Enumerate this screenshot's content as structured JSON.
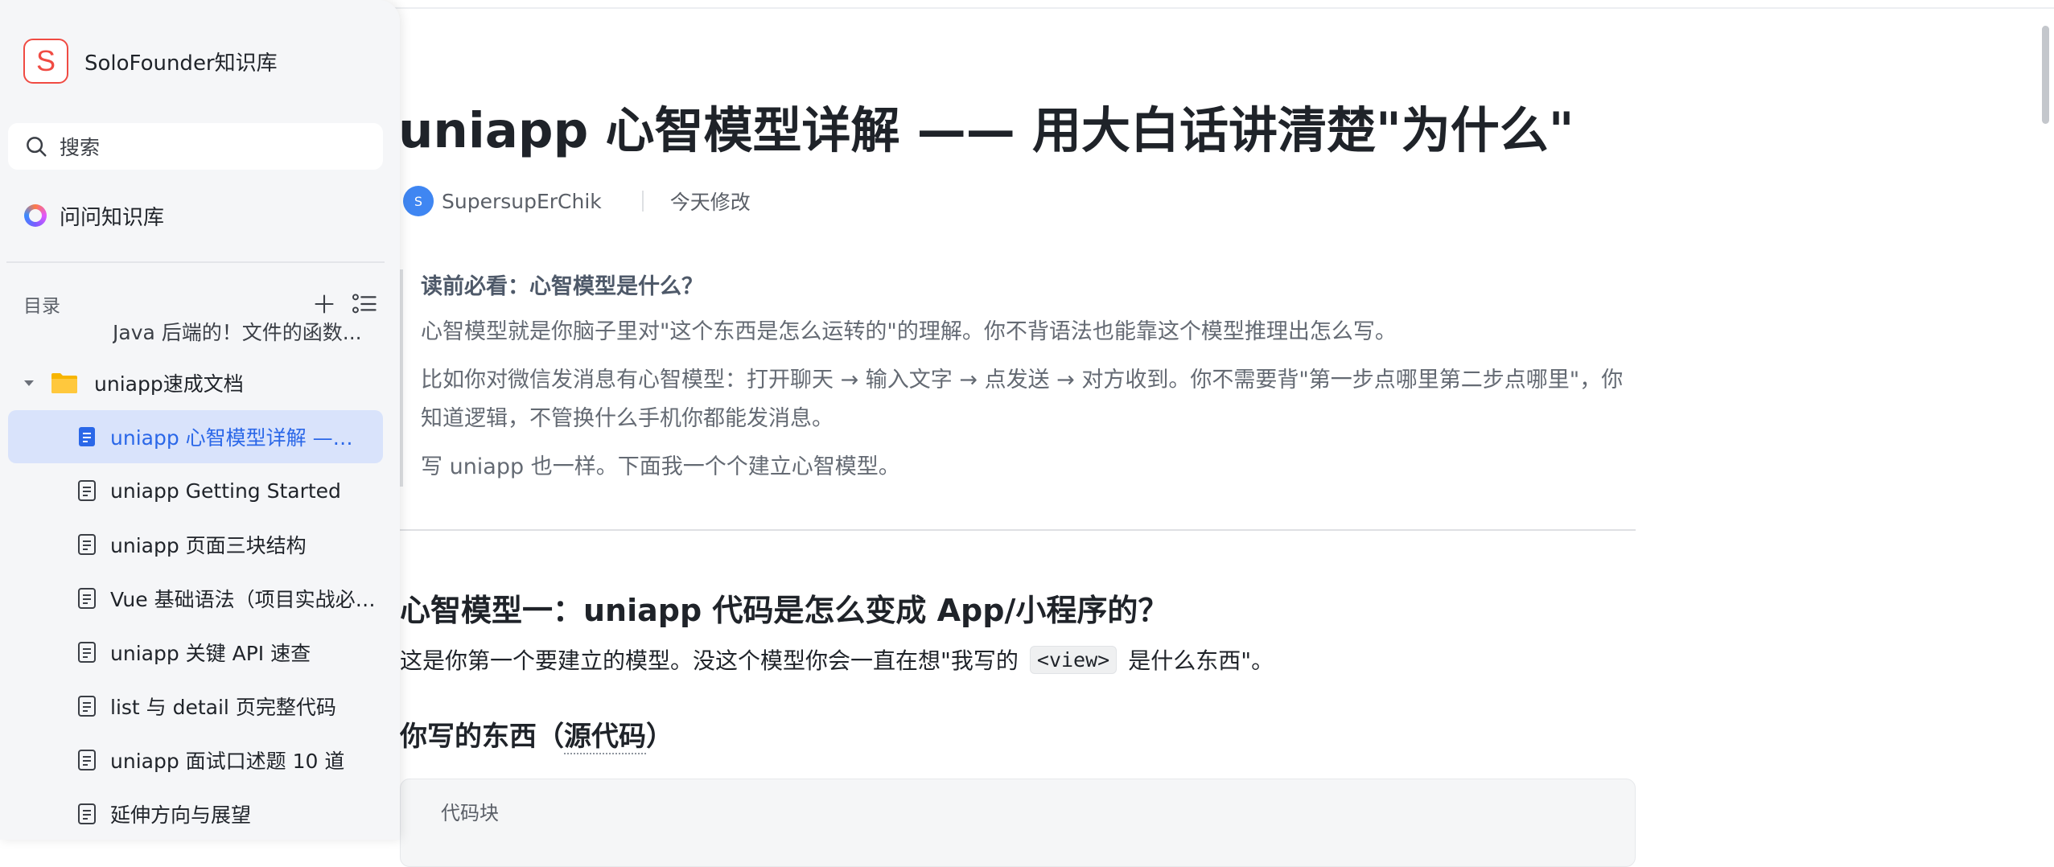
{
  "brand": {
    "logo_letter": "S",
    "name": "SoloFounder知识库",
    "accent": "#f04b43"
  },
  "search": {
    "placeholder": "搜索"
  },
  "ask": {
    "label": "问问知识库"
  },
  "toc": {
    "title": "目录",
    "truncated_top_item": "Java 后端的！文件的函数...",
    "folder": "uniapp速成文档",
    "items": [
      {
        "label": "uniapp 心智模型详解 —— 用大白话讲清楚\"为什么\"",
        "active": true
      },
      {
        "label": "uniapp Getting Started"
      },
      {
        "label": "uniapp 页面三块结构"
      },
      {
        "label": "Vue 基础语法（项目实战必会）"
      },
      {
        "label": "uniapp 关键 API 速查"
      },
      {
        "label": "list 与 detail 页完整代码"
      },
      {
        "label": "uniapp 面试口述题 10 道"
      },
      {
        "label": "延伸方向与展望"
      }
    ]
  },
  "doc": {
    "title": "uniapp 心智模型详解 —— 用大白话讲清楚\"为什么\"",
    "author_initial": "S",
    "author": "SupersupErChik",
    "modified": "今天修改",
    "callout": {
      "title": "读前必看：心智模型是什么？",
      "p1": "心智模型就是你脑子里对\"这个东西是怎么运转的\"的理解。你不背语法也能靠这个模型推理出怎么写。",
      "p2": "比如你对微信发消息有心智模型：打开聊天 → 输入文字 → 点发送 → 对方收到。你不需要背\"第一步点哪里第二步点哪里\"，你知道逻辑，不管换什么手机你都能发消息。",
      "p3": "写 uniapp 也一样。下面我一个个建立心智模型。"
    },
    "h2": "心智模型一：uniapp 代码是怎么变成 App/小程序的？",
    "para_before": "这是你第一个要建立的模型。没这个模型你会一直在想\"我写的",
    "para_code": "<view>",
    "para_after": "是什么东西\"。",
    "h3_before": "你写的东西（",
    "h3_mid": "源代码",
    "h3_after": "）",
    "codeblock_label": "代码块"
  },
  "colors": {
    "active_bg": "#d9e3fb",
    "active_text": "#2a67e8",
    "sidebar_bg": "#f5f6f8"
  }
}
